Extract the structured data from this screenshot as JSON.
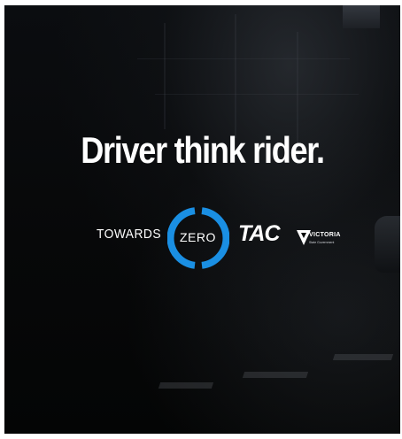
{
  "poster": {
    "headline": "Driver think rider.",
    "towards_zero": {
      "left_word": "TOWARDS",
      "right_word": "ZERO",
      "ring_color": "#1a8fe3"
    },
    "tac_logo": "TAC",
    "victoria": {
      "name": "VICTORIA",
      "sub": "State Government"
    }
  },
  "colors": {
    "background": "#050607",
    "headline": "#ffffff",
    "frame": "#ffffff"
  }
}
